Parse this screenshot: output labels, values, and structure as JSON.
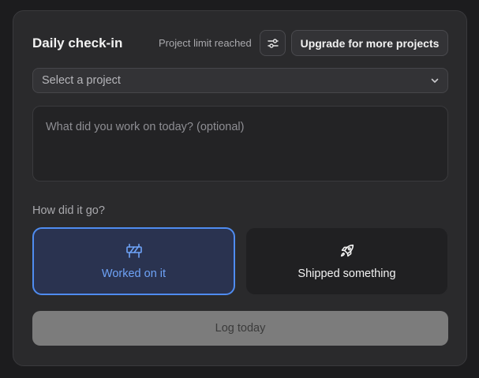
{
  "checkin": {
    "title": "Daily check-in",
    "limit_text": "Project limit reached",
    "upgrade_label": "Upgrade for more projects",
    "settings_icon": "sliders-icon"
  },
  "project_select": {
    "value": "Select a project",
    "icon": "chevron-down-icon"
  },
  "notes": {
    "placeholder": "What did you work on today? (optional)",
    "value": ""
  },
  "outcome": {
    "question": "How did it go?",
    "options": [
      {
        "label": "Worked on it",
        "icon": "barrier-icon",
        "selected": true
      },
      {
        "label": "Shipped something",
        "icon": "rocket-icon",
        "selected": false
      }
    ]
  },
  "submit": {
    "label": "Log today"
  },
  "colors": {
    "accent": "#4f8cf0",
    "card_bg": "#2a2a2c",
    "page_bg": "#1c1c1e"
  }
}
